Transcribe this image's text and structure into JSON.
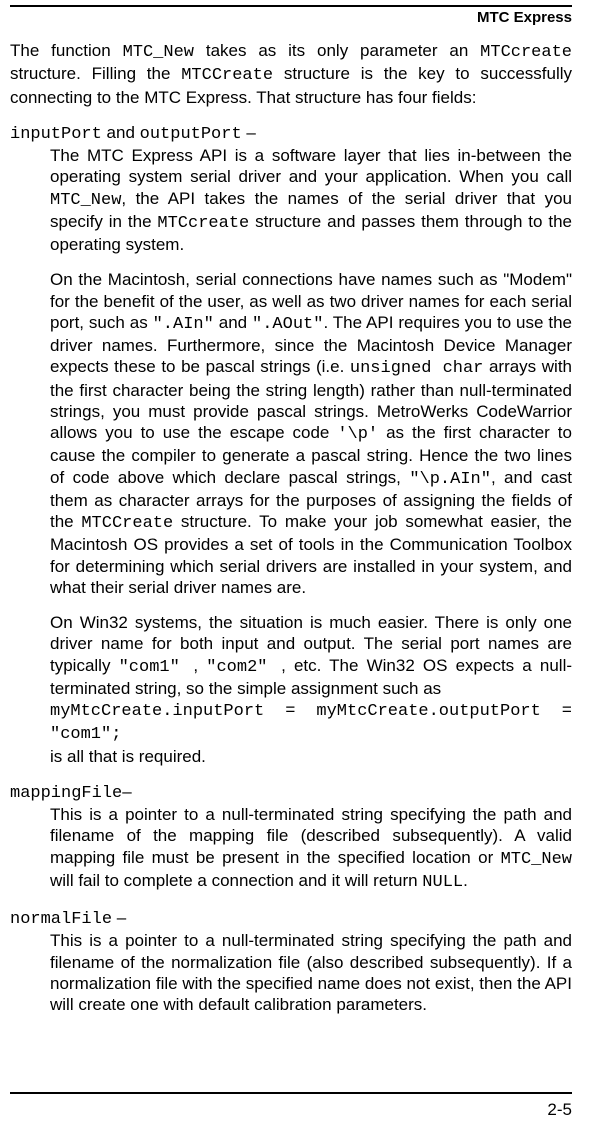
{
  "header": {
    "title": "MTC Express"
  },
  "intro": {
    "t1": "The function ",
    "m1": "MTC_New",
    "t2": " takes as its only parameter an ",
    "m2": "MTCcreate",
    "t3": " structure. Filling the ",
    "m3": "MTCCreate",
    "t4": " structure is the key to successfully connecting to the MTC Express.  That structure has four fields:"
  },
  "io": {
    "m1": "inputPort",
    "t1": " and ",
    "m2": "outputPort",
    "t2": " –",
    "p1a": "The MTC Express API is a software layer that lies in-between the operating system serial driver and your application.  When you call ",
    "p1m1": "MTC_New",
    "p1b": ", the API takes the names of the serial driver that you specify in the ",
    "p1m2": "MTCcreate",
    "p1c": " structure and passes them through to the operating system.",
    "p2a": "On the Macintosh, serial connections have names such as \"Modem\" for the benefit of the user, as well as two driver names for each serial port, such as ",
    "p2m1": "\".AIn\"",
    "p2b": " and ",
    "p2m2": "\".AOut\"",
    "p2c": ".  The API requires you to use the driver names.  Furthermore, since the Macintosh Device Manager expects these to be pascal strings (i.e. ",
    "p2m3": "unsigned char",
    "p2d": " arrays with the first character being  the string length) rather than null-terminated strings, you must provide pascal strings. MetroWerks CodeWarrior allows you to use the escape code ",
    "p2m4": "'\\p'",
    "p2e": " as the first character to cause the compiler to generate a pascal string.   Hence the two lines of code above which declare pascal strings, ",
    "p2m5": "\"\\p.AIn\"",
    "p2f": ",  and cast them as character arrays for the purposes of assigning the fields of the ",
    "p2m6": "MTCCreate",
    "p2g": " structure.  To make your job somewhat easier, the Macintosh OS provides a set of tools in the Communication Toolbox for determining which serial drivers are installed in your system, and what their serial driver names are.",
    "p3a": "On Win32 systems, the situation is much easier.  There is only one driver name for both input and output.  The serial port names are typically ",
    "p3m1": "\"com1\" ",
    "p3b": ", ",
    "p3m2": "\"com2\" ",
    "p3c": ", etc.    The Win32 OS expects a null-terminated string, so the simple assignment such as",
    "p3m3": "myMtcCreate.inputPort = myMtcCreate.outputPort = \"com1\";",
    "p3d": "is all that is required."
  },
  "mapping": {
    "m1": "mappingFile",
    "t1": "–",
    "p1a": "This is a pointer to a null-terminated string specifying the path and filename of the mapping file (described subsequently).  A valid mapping file must be present in the specified location or ",
    "p1m1": "MTC_New",
    "p1b": " will fail to complete a connection and it will return ",
    "p1m2": "NULL",
    "p1c": "."
  },
  "normal": {
    "m1": "normalFile",
    "t1": " –",
    "p1": "This is a pointer to a null-terminated string specifying the path and filename of the normalization file (also described subsequently).  If a normalization file with the specified name does not exist, then the API will create one with default calibration parameters."
  },
  "pageno": "2-5"
}
